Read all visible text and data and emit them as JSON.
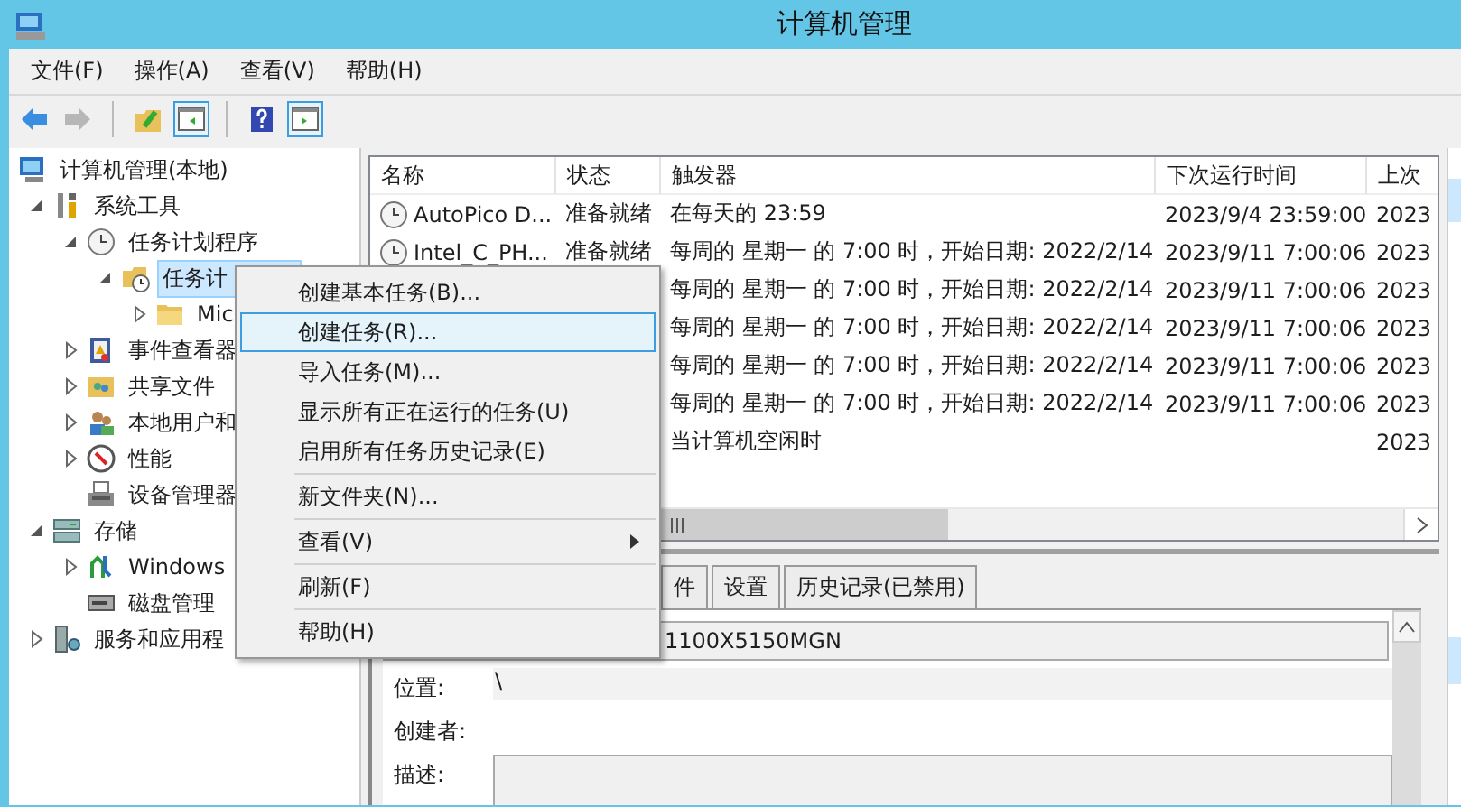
{
  "window": {
    "title": "计算机管理"
  },
  "menu_bar": [
    "文件(F)",
    "操作(A)",
    "查看(V)",
    "帮助(H)"
  ],
  "toolbar": [
    {
      "disabled": false,
      "on": false
    },
    {
      "disabled": true,
      "on": false
    },
    {
      "disabled": false,
      "on": false
    },
    {
      "disabled": false,
      "on": true
    },
    {
      "disabled": false,
      "on": false
    },
    {
      "disabled": false,
      "on": true
    }
  ],
  "tree": [
    {
      "label": "计算机管理(本地)",
      "selected": false,
      "children": [
        {
          "label": "系统工具",
          "expanded": true,
          "selected": false,
          "children": [
            {
              "label": "任务计划程序",
              "expanded": true,
              "selected": false,
              "children": [
                {
                  "label": "任务计",
                  "expanded": true,
                  "selected": true,
                  "children": [
                    {
                      "label": "Mic",
                      "expanded": false,
                      "selected": false
                    }
                  ]
                }
              ]
            },
            {
              "label": "事件查看器",
              "expanded": false,
              "selected": false
            },
            {
              "label": "共享文件",
              "expanded": false,
              "selected": false
            },
            {
              "label": "本地用户和",
              "expanded": false,
              "selected": false
            },
            {
              "label": "性能",
              "expanded": false,
              "selected": false
            },
            {
              "label": "设备管理器",
              "selected": false
            }
          ]
        },
        {
          "label": "存储",
          "expanded": true,
          "selected": false,
          "children": [
            {
              "label": "Windows",
              "expanded": false,
              "selected": false
            },
            {
              "label": "磁盘管理",
              "selected": false
            }
          ]
        },
        {
          "label": "服务和应用程",
          "expanded": false,
          "selected": false
        }
      ]
    }
  ],
  "table": {
    "columns": [
      "名称",
      "状态",
      "触发器",
      "下次运行时间",
      "上次"
    ],
    "rows": [
      {
        "name": "AutoPico D...",
        "status": "准备就绪",
        "trigger": "在每天的 23:59",
        "next_run": "2023/9/4 23:59:00",
        "last_run": "2023"
      },
      {
        "name": "Intel_C_PH...",
        "status": "准备就绪",
        "trigger": "每周的 星期一 的 7:00 时，开始日期: 2022/2/14",
        "next_run": "2023/9/11 7:00:06",
        "last_run": "2023"
      },
      {
        "trigger": "每周的 星期一 的 7:00 时，开始日期: 2022/2/14",
        "next_run": "2023/9/11 7:00:06",
        "last_run": "2023"
      },
      {
        "trigger": "每周的 星期一 的 7:00 时，开始日期: 2022/2/14",
        "next_run": "2023/9/11 7:00:06",
        "last_run": "2023"
      },
      {
        "trigger": "每周的 星期一 的 7:00 时，开始日期: 2022/2/14",
        "next_run": "2023/9/11 7:00:06",
        "last_run": "2023"
      },
      {
        "trigger": "每周的 星期一 的 7:00 时，开始日期: 2022/2/14",
        "next_run": "2023/9/11 7:00:06",
        "last_run": "2023"
      },
      {
        "trigger": "当计算机空闲时",
        "last_run": "2023"
      }
    ]
  },
  "details": {
    "tabs": [
      {
        "label": "件",
        "selected": false
      },
      {
        "label": "设置",
        "selected": false
      },
      {
        "label": "历史记录(已禁用)",
        "selected": false
      }
    ],
    "name_value": "1100X5150MGN",
    "fields": [
      {
        "kind": "text",
        "label": "位置:",
        "value": "\\"
      },
      {
        "kind": "text",
        "label": "创建者:"
      },
      {
        "kind": "textarea",
        "label": "描述:"
      }
    ]
  },
  "context_menu": [
    {
      "kind": "item",
      "label": "创建基本任务(B)...",
      "selected": false
    },
    {
      "kind": "item",
      "label": "创建任务(R)...",
      "selected": true
    },
    {
      "kind": "item",
      "label": "导入任务(M)...",
      "selected": false
    },
    {
      "kind": "item",
      "label": "显示所有正在运行的任务(U)",
      "selected": false
    },
    {
      "kind": "item",
      "label": "启用所有任务历史记录(E)",
      "selected": false
    },
    {
      "kind": "separator"
    },
    {
      "kind": "item",
      "label": "新文件夹(N)...",
      "selected": false
    },
    {
      "kind": "separator"
    },
    {
      "kind": "item",
      "label": "查看(V)",
      "selected": false,
      "submenu": true
    },
    {
      "kind": "separator"
    },
    {
      "kind": "item",
      "label": "刷新(F)",
      "selected": false
    },
    {
      "kind": "separator"
    },
    {
      "kind": "item",
      "label": "帮助(H)",
      "selected": false
    }
  ]
}
